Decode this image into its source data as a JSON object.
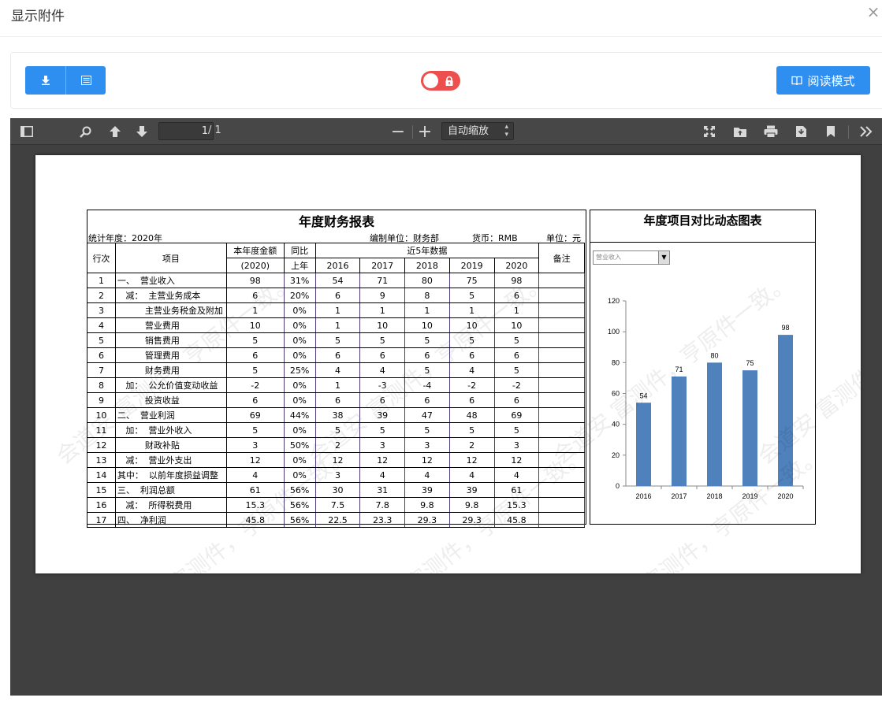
{
  "dialog": {
    "title": "显示附件",
    "close": "×"
  },
  "toolbar": {
    "read_mode_label": "阅读模式"
  },
  "viewer": {
    "page_current": "1",
    "page_total": "/ 1",
    "zoom_label": "自动缩放",
    "zoom_minus": "−",
    "zoom_plus": "+"
  },
  "report": {
    "title": "年度财务报表",
    "year_label": "统计年度：2020年",
    "unit_org": "编制单位：财务部",
    "currency": "货币：RMB",
    "unit": "单位：元",
    "headers": {
      "row_no": "行次",
      "item": "项目",
      "amount_line1": "本年度金额",
      "amount_line2": "(2020)",
      "yoy_line1": "同比",
      "yoy_line2": "上年",
      "recent": "近5年数据",
      "years": [
        "2016",
        "2017",
        "2018",
        "2019",
        "2020"
      ],
      "note": "备注"
    },
    "rows": [
      {
        "n": "1",
        "item": "一、  营业收入",
        "amt": "98",
        "yoy": "31%",
        "y": [
          "54",
          "71",
          "80",
          "75",
          "98"
        ]
      },
      {
        "n": "2",
        "item": "   减：  主营业务成本",
        "amt": "6",
        "yoy": "20%",
        "y": [
          "6",
          "9",
          "8",
          "5",
          "6"
        ]
      },
      {
        "n": "3",
        "item": "          主营业务税金及附加",
        "amt": "1",
        "yoy": "0%",
        "y": [
          "1",
          "1",
          "1",
          "1",
          "1"
        ]
      },
      {
        "n": "4",
        "item": "          营业费用",
        "amt": "10",
        "yoy": "0%",
        "y": [
          "1",
          "10",
          "10",
          "10",
          "10"
        ]
      },
      {
        "n": "5",
        "item": "          销售费用",
        "amt": "5",
        "yoy": "0%",
        "y": [
          "5",
          "5",
          "5",
          "5",
          "5"
        ]
      },
      {
        "n": "6",
        "item": "          管理费用",
        "amt": "6",
        "yoy": "0%",
        "y": [
          "6",
          "6",
          "6",
          "6",
          "6"
        ]
      },
      {
        "n": "7",
        "item": "          财务费用",
        "amt": "5",
        "yoy": "25%",
        "y": [
          "4",
          "4",
          "5",
          "4",
          "5"
        ]
      },
      {
        "n": "8",
        "item": "   加：  公允价值变动收益",
        "amt": "-2",
        "yoy": "0%",
        "y": [
          "1",
          "-3",
          "-4",
          "-2",
          "-2"
        ]
      },
      {
        "n": "9",
        "item": "          投资收益",
        "amt": "6",
        "yoy": "0%",
        "y": [
          "6",
          "6",
          "6",
          "6",
          "6"
        ]
      },
      {
        "n": "10",
        "item": "二、  营业利润",
        "amt": "69",
        "yoy": "44%",
        "y": [
          "38",
          "39",
          "47",
          "48",
          "69"
        ]
      },
      {
        "n": "11",
        "item": "   加：  营业外收入",
        "amt": "5",
        "yoy": "0%",
        "y": [
          "5",
          "5",
          "5",
          "5",
          "5"
        ]
      },
      {
        "n": "12",
        "item": "          财政补贴",
        "amt": "3",
        "yoy": "50%",
        "y": [
          "2",
          "3",
          "3",
          "2",
          "3"
        ]
      },
      {
        "n": "13",
        "item": "   减：  营业外支出",
        "amt": "12",
        "yoy": "0%",
        "y": [
          "12",
          "12",
          "12",
          "12",
          "12"
        ]
      },
      {
        "n": "14",
        "item": "其中：  以前年度损益调整",
        "amt": "4",
        "yoy": "0%",
        "y": [
          "3",
          "4",
          "4",
          "4",
          "4"
        ]
      },
      {
        "n": "15",
        "item": "三、  利润总额",
        "amt": "61",
        "yoy": "56%",
        "y": [
          "30",
          "31",
          "39",
          "39",
          "61"
        ]
      },
      {
        "n": "16",
        "item": "   减：  所得税费用",
        "amt": "15.3",
        "yoy": "56%",
        "y": [
          "7.5",
          "7.8",
          "9.8",
          "9.8",
          "15.3"
        ]
      },
      {
        "n": "17",
        "item": "四、  净利润",
        "amt": "45.8",
        "yoy": "56%",
        "y": [
          "22.5",
          "23.3",
          "29.3",
          "29.3",
          "45.8"
        ]
      }
    ]
  },
  "chart": {
    "panel_title": "年度项目对比动态图表",
    "select_value": "营业收入"
  },
  "chart_data": {
    "type": "bar",
    "categories": [
      "2016",
      "2017",
      "2018",
      "2019",
      "2020"
    ],
    "values": [
      54,
      71,
      80,
      75,
      98
    ],
    "ylim": [
      0,
      120
    ],
    "yticks": [
      0,
      20,
      40,
      60,
      80,
      100,
      120
    ],
    "bar_color": "#4f81bd",
    "grid": false,
    "data_labels": true
  },
  "watermark": {
    "text": "会道安 富测件，亨原件一致。"
  },
  "colors": {
    "primary": "#2f8ff0",
    "toggle_locked": "#ed4f4f",
    "viewer_bg": "#404040",
    "viewer_toolbar": "#474747"
  }
}
